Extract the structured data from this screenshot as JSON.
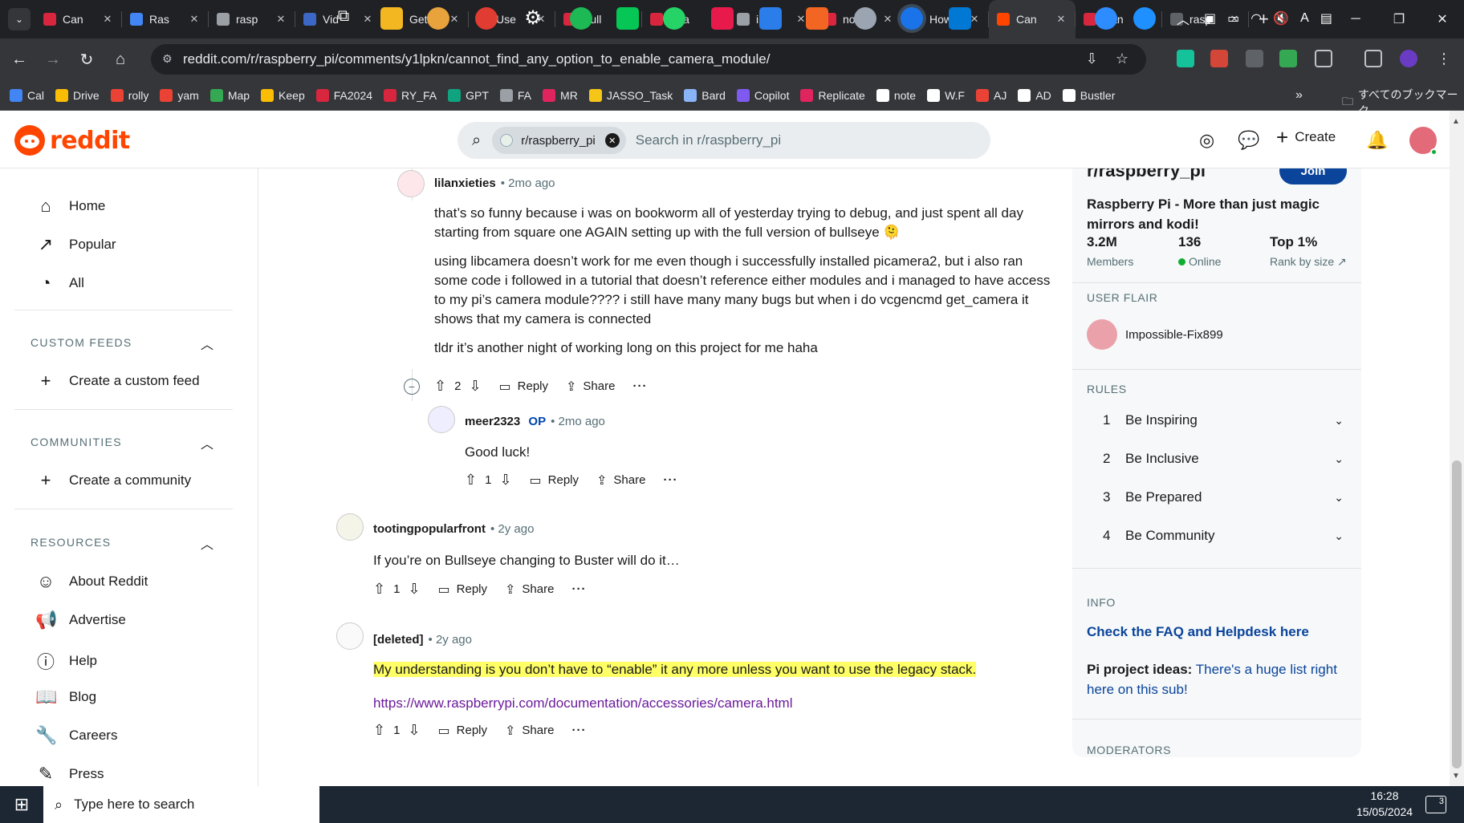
{
  "browser": {
    "tabs": [
      {
        "label": "Can",
        "color": "#d7263d"
      },
      {
        "label": "Ras",
        "color": "#4285f4"
      },
      {
        "label": "rasp",
        "color": "#9aa0a6"
      },
      {
        "label": "Vid",
        "color": "#3d67c6"
      },
      {
        "label": "Get",
        "color": "#d7263d"
      },
      {
        "label": "Use",
        "color": "#ff0000"
      },
      {
        "label": "Bull",
        "color": "#d7263d"
      },
      {
        "label": "Ena",
        "color": "#d7263d"
      },
      {
        "label": "i do",
        "color": "#9aa0a6"
      },
      {
        "label": "no c",
        "color": "#d7263d"
      },
      {
        "label": "How",
        "color": "#ff0000"
      },
      {
        "label": "Can",
        "color": "#ff4500",
        "active": true
      },
      {
        "label": "Can",
        "color": "#d7263d"
      },
      {
        "label": "rasp",
        "color": "#5f6368"
      }
    ],
    "url": "reddit.com/r/raspberry_pi/comments/y1lpkn/cannot_find_any_option_to_enable_camera_module/",
    "bookmarks": [
      {
        "label": "Cal",
        "color": "#4285f4"
      },
      {
        "label": "Drive",
        "color": "#fbbc04"
      },
      {
        "label": "rolly",
        "color": "#ea4335"
      },
      {
        "label": "yam",
        "color": "#ea4335"
      },
      {
        "label": "Map",
        "color": "#34a853"
      },
      {
        "label": "Keep",
        "color": "#fbbc04"
      },
      {
        "label": "FA2024",
        "color": "#d7263d"
      },
      {
        "label": "RY_FA",
        "color": "#d7263d"
      },
      {
        "label": "GPT",
        "color": "#10a37f"
      },
      {
        "label": "FA",
        "color": "#9aa0a6"
      },
      {
        "label": "MR",
        "color": "#e0245e"
      },
      {
        "label": "JASSO_Task",
        "color": "#f5c518"
      },
      {
        "label": "Bard",
        "color": "#8ab4f8"
      },
      {
        "label": "Copilot",
        "color": "#7f5af0"
      },
      {
        "label": "Replicate",
        "color": "#e0245e"
      },
      {
        "label": "note",
        "color": "#ffffff"
      },
      {
        "label": "W.F",
        "color": "#ffffff"
      },
      {
        "label": "AJ",
        "color": "#ea4335"
      },
      {
        "label": "AD",
        "color": "#ffffff"
      },
      {
        "label": "Bustler",
        "color": "#ffffff"
      }
    ],
    "all_bookmarks": "すべてのブックマーク"
  },
  "reddit": {
    "wordmark": "reddit",
    "search": {
      "chip": "r/raspberry_pi",
      "placeholder": "Search in r/raspberry_pi"
    },
    "create": "Create",
    "leftnav": {
      "main": [
        "Home",
        "Popular",
        "All"
      ],
      "custom_feeds_heading": "CUSTOM FEEDS",
      "create_custom_feed": "Create a custom feed",
      "communities_heading": "COMMUNITIES",
      "create_community": "Create a community",
      "resources_heading": "RESOURCES",
      "resources": [
        "About Reddit",
        "Advertise",
        "Help",
        "Blog",
        "Careers",
        "Press"
      ]
    },
    "comments": [
      {
        "author": "lilanxieties",
        "time": "2mo ago",
        "paragraphs": [
          "that’s so funny because i was on bookworm all of yesterday trying to debug, and just spent all day starting from square one AGAIN setting up with the full version of bullseye 🫠",
          "using libcamera doesn’t work for me even though i successfully installed picamera2, but i also ran some code i followed in a tutorial that doesn’t reference either modules and i managed to have access to my pi’s camera module???? i still have many many bugs but when i do vcgencmd get_camera it shows that my camera is connected",
          "tldr it’s another night of working long on this project for me haha"
        ],
        "score": "2",
        "reply": "Reply",
        "share": "Share"
      },
      {
        "author": "meer2323",
        "op": "OP",
        "time": "2mo ago",
        "text": "Good luck!",
        "score": "1",
        "reply": "Reply",
        "share": "Share"
      },
      {
        "author": "tootingpopularfront",
        "time": "2y ago",
        "text": "If you’re on Bullseye changing to Buster will do it…",
        "score": "1",
        "reply": "Reply",
        "share": "Share"
      },
      {
        "author": "[deleted]",
        "time": "2y ago",
        "text": "My understanding is you don’t have to “enable” it any more unless you want to use the legacy stack.",
        "link": "https://www.raspberrypi.com/documentation/accessories/camera.html",
        "score": "1",
        "reply": "Reply",
        "share": "Share"
      }
    ],
    "sidebar": {
      "title": "r/raspberry_pi",
      "join": "Join",
      "description": "Raspberry Pi - More than just magic mirrors and kodi!",
      "stats": [
        {
          "value": "3.2M",
          "label": "Members"
        },
        {
          "value": "136",
          "label": "Online"
        },
        {
          "value": "Top 1%",
          "label": "Rank by size ↗"
        }
      ],
      "user_flair_heading": "USER FLAIR",
      "flair_user": "Impossible-Fix899",
      "rules_heading": "RULES",
      "rules": [
        {
          "n": "1",
          "text": "Be Inspiring"
        },
        {
          "n": "2",
          "text": "Be Inclusive"
        },
        {
          "n": "3",
          "text": "Be Prepared"
        },
        {
          "n": "4",
          "text": "Be Community"
        }
      ],
      "info_heading": "INFO",
      "faq_link": "Check the FAQ and Helpdesk here",
      "pi_ideas_label": "Pi project ideas:",
      "pi_ideas_text": " There's a huge list right here on this sub!",
      "moderators_heading": "MODERATORS"
    }
  },
  "taskbar": {
    "search_placeholder": "Type here to search",
    "time": "16:28",
    "date": "15/05/2024",
    "notifications": "3",
    "ime": "A"
  }
}
